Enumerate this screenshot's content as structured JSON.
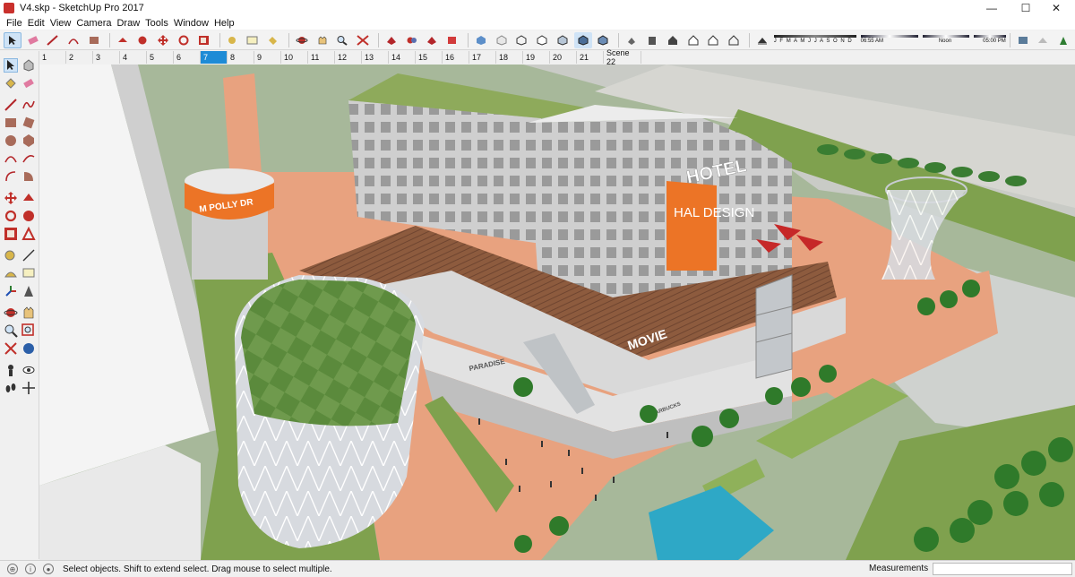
{
  "window": {
    "title": "V4.skp - SketchUp Pro 2017",
    "minimize": "—",
    "maximize": "☐",
    "close": "✕"
  },
  "menu": [
    "File",
    "Edit",
    "View",
    "Camera",
    "Draw",
    "Tools",
    "Window",
    "Help"
  ],
  "shadow": {
    "months": "J F M A M J J A S O N D",
    "time_start": "06:55 AM",
    "time_mid": "Noon",
    "time_end": "05:00 PM"
  },
  "scenes": [
    "1",
    "2",
    "3",
    "4",
    "5",
    "6",
    "7",
    "8",
    "9",
    "10",
    "11",
    "12",
    "13",
    "14",
    "15",
    "16",
    "17",
    "18",
    "19",
    "20",
    "21",
    "Scene 22"
  ],
  "active_scene": "7",
  "model_signs": {
    "hotel": "HOTEL",
    "brand": "HAL DESIGN",
    "cinema": "MOVIE",
    "paradise": "PARADISE",
    "starbucks": "STARBUCKS",
    "drum": "M POLLY DR"
  },
  "status": {
    "text": "Select objects. Shift to extend select. Drag mouse to select multiple.",
    "measurements_label": "Measurements",
    "measurements_value": ""
  },
  "colors": {
    "accent": "#1e8bd6",
    "plaza": "#e8a27f",
    "grass": "#7fa14e",
    "brand_orange": "#ec7426"
  },
  "icons": [
    "select-arrow-icon",
    "eraser-icon",
    "pencil-icon",
    "paint-bucket-icon",
    "move-icon",
    "rotate-icon",
    "orbit-icon",
    "pan-icon",
    "zoom-icon",
    "zoom-extents-icon",
    "tape-measure-icon",
    "text-icon",
    "axes-icon",
    "section-plane-icon",
    "walk-icon",
    "look-around-icon",
    "footprints-icon"
  ]
}
